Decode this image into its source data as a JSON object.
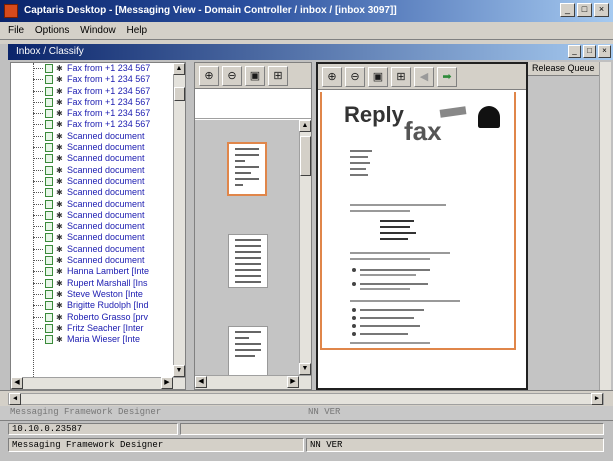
{
  "window": {
    "title": "Captaris Desktop - [Messaging View - Domain Controller / inbox / [inbox 3097]]",
    "controls": [
      "_",
      "□",
      "×"
    ]
  },
  "menubar": {
    "items": [
      "File",
      "Options",
      "Window",
      "Help"
    ]
  },
  "child_window": {
    "title": "Inbox / Classify",
    "controls": [
      "_",
      "□",
      "×"
    ]
  },
  "tree": {
    "items": [
      "Fax from +1 234 567",
      "Fax from +1 234 567",
      "Fax from +1 234 567",
      "Fax from +1 234 567",
      "Fax from +1 234 567",
      "Fax from +1 234 567",
      "Scanned document",
      "Scanned document",
      "Scanned document",
      "Scanned document",
      "Scanned document",
      "Scanned document",
      "Scanned document",
      "Scanned document",
      "Scanned document",
      "Scanned document",
      "Scanned document",
      "Scanned document",
      "Hanna Lambert [Inte",
      "Rupert Marshall [Ins",
      "Steve Weston [Inte",
      "Brigitte Rudolph [Ind",
      "Roberto Grasso [prv",
      "Fritz Seacher [Inter",
      "Maria Wieser [Inte"
    ]
  },
  "thumb_toolbar": {
    "buttons": [
      {
        "icon": "zoom-in-icon",
        "glyph": "⊕"
      },
      {
        "icon": "zoom-out-icon",
        "glyph": "⊖"
      },
      {
        "icon": "fit-page-icon",
        "glyph": "▣"
      },
      {
        "icon": "fit-width-icon",
        "glyph": "⊞"
      }
    ]
  },
  "viewer_toolbar": {
    "buttons": [
      {
        "icon": "zoom-in-icon",
        "glyph": "⊕"
      },
      {
        "icon": "zoom-out-icon",
        "glyph": "⊖"
      },
      {
        "icon": "fit-page-icon",
        "glyph": "▣"
      },
      {
        "icon": "fit-width-icon",
        "glyph": "⊞"
      },
      {
        "icon": "back-icon",
        "glyph": "◀",
        "disabled": true
      },
      {
        "icon": "forward-icon",
        "glyph": "➡"
      }
    ]
  },
  "document": {
    "heading_reply": "Reply",
    "heading_fax": "fax"
  },
  "status_pane": {
    "header": "Release Queue"
  },
  "bottom": {
    "ghost_left": "Messaging Framework Designer",
    "ghost_right": "NN VER",
    "cell_left": "10.10.0.23587",
    "name": "Messaging Framework Designer",
    "version": "NN VER"
  },
  "colors": {
    "title_gradient_start": "#0a246a",
    "title_gradient_end": "#a6caf0",
    "tree_text": "#1b1bb0",
    "thumb_selected_border": "#e0864a"
  }
}
